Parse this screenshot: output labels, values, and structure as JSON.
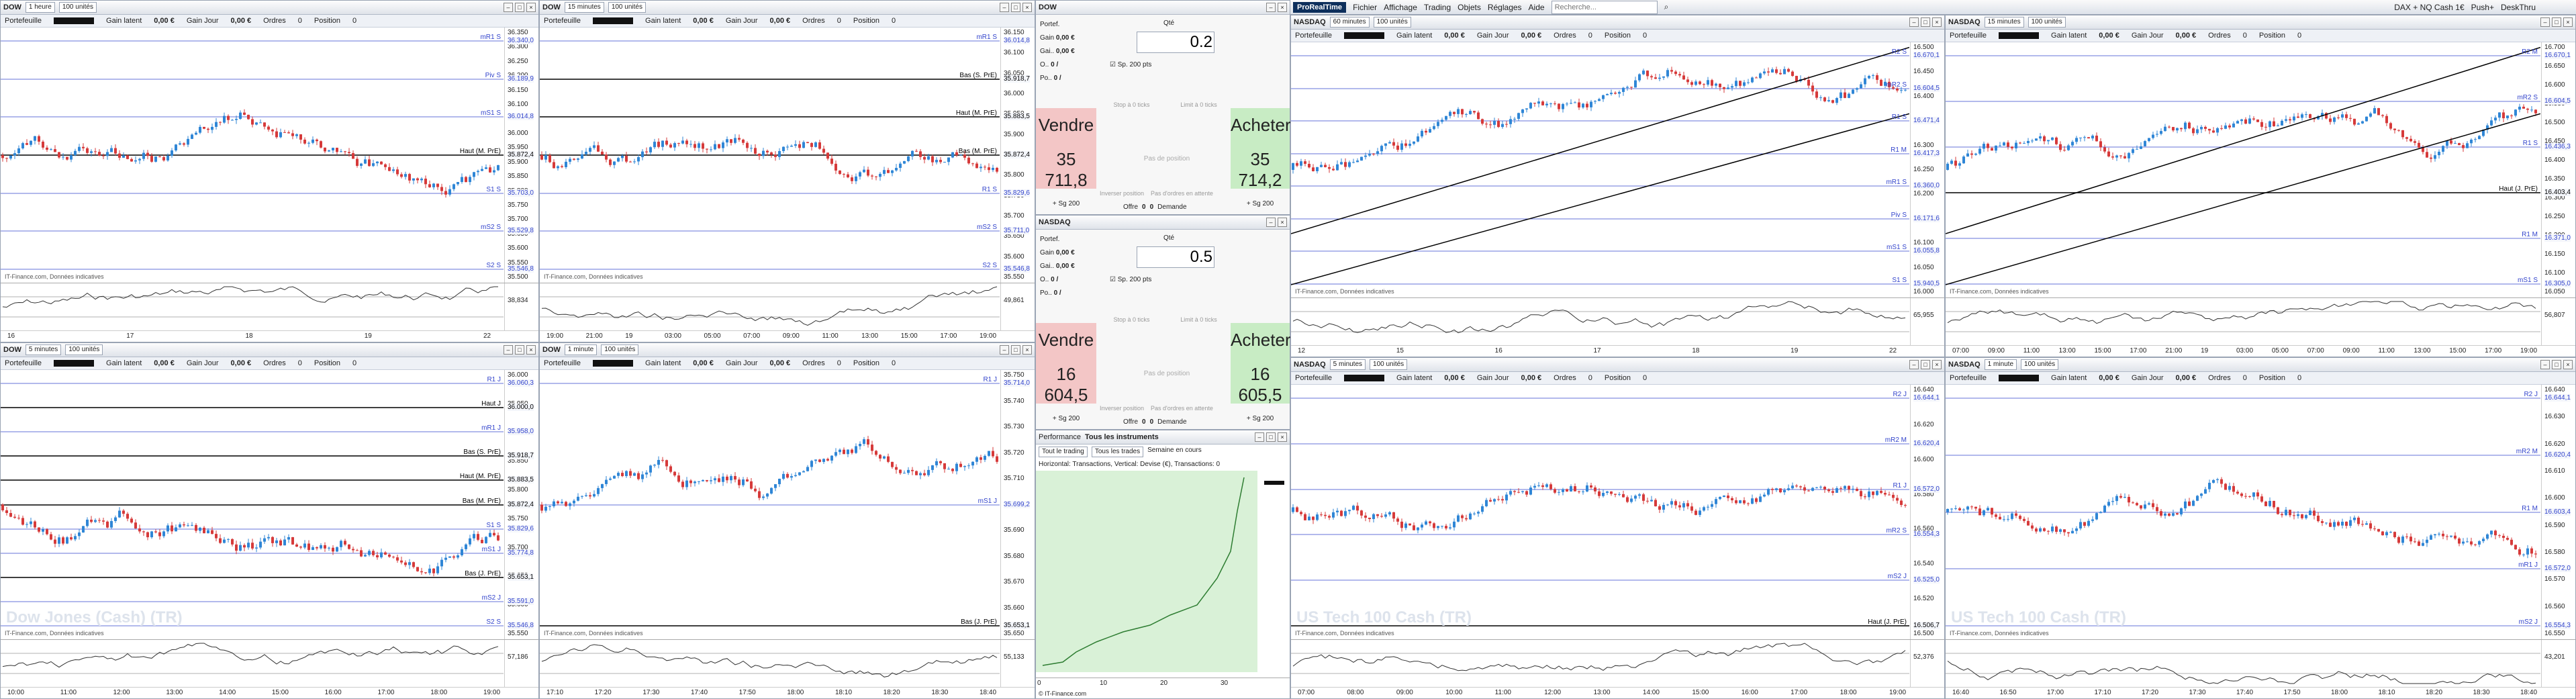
{
  "topbar": {
    "logo": "ProRealTime",
    "menus": [
      "Fichier",
      "Affichage",
      "Trading",
      "Objets",
      "Réglages",
      "Aide"
    ],
    "search_placeholder": "Recherche...",
    "right": [
      "DAX + NQ Cash 1€",
      "Push+",
      "DeskThru"
    ]
  },
  "info": {
    "portfolio": "Portefeuille",
    "latent": "Gain latent",
    "latent_val": "0,00 €",
    "day": "Gain Jour",
    "day_val": "0,00 €",
    "orders": "Ordres",
    "orders_val": "0",
    "position": "Position",
    "position_val": "0",
    "position_unit": "€"
  },
  "source": "IT-Finance.com, Données indicatives",
  "charts": [
    {
      "symbol": "DOW",
      "tf": "1 heure",
      "units": "100 unités",
      "ticks": [
        "36.350",
        "36.300",
        "36.250",
        "36.200",
        "36.150",
        "36.100",
        "36.050",
        "36.000",
        "35.950",
        "35.900",
        "35.850",
        "35.800",
        "35.750",
        "35.700",
        "35.650",
        "35.600",
        "35.550",
        "35.500"
      ],
      "xlabels": [
        "16",
        "17",
        "18",
        "19",
        "22"
      ],
      "levels": [
        "mR1 S",
        "Piv S",
        "mS1 S",
        "Haut (M. PrE)",
        "S1 S",
        "mS2 S",
        "S2 S"
      ],
      "values": [
        "36.340,0",
        "36.189,9",
        "36.014,8",
        "35.872,4",
        "35.703,0",
        "35.529,8",
        "35.546,8"
      ],
      "osc": "38,834"
    },
    {
      "symbol": "DOW",
      "tf": "15 minutes",
      "units": "100 unités",
      "ticks": [
        "36.150",
        "36.100",
        "36.050",
        "36.000",
        "35.950",
        "35.900",
        "35.850",
        "35.800",
        "35.750",
        "35.700",
        "35.650",
        "35.600",
        "35.550"
      ],
      "xlabels": [
        "19:00",
        "21:00",
        "19",
        "03:00",
        "05:00",
        "07:00",
        "09:00",
        "11:00",
        "13:00",
        "15:00",
        "17:00",
        "19:00"
      ],
      "levels": [
        "mR1 S",
        "Bas (S. PrE)",
        "Haut (M. PrE)",
        "Bas (M. PrE)",
        "R1 S",
        "mS2 S",
        "S2 S"
      ],
      "values": [
        "36.014,8",
        "35.918,7",
        "35.883,5",
        "35.872,4",
        "35.829,6",
        "35.711,0",
        "35.546,8"
      ],
      "osc": "49,861"
    },
    {
      "symbol": "DOW",
      "tf": "5 minutes",
      "units": "100 unités",
      "ticks": [
        "36.000",
        "35.950",
        "35.900",
        "35.850",
        "35.800",
        "35.750",
        "35.700",
        "35.650",
        "35.600",
        "35.550"
      ],
      "xlabels": [
        "10:00",
        "11:00",
        "12:00",
        "13:00",
        "14:00",
        "15:00",
        "16:00",
        "17:00",
        "18:00",
        "19:00"
      ],
      "levels": [
        "R1 J",
        "Haut J",
        "mR1 J",
        "Bas (S. PrE)",
        "Haut (M. PrE)",
        "Bas (M. PrE)",
        "S1 S",
        "mS1 J",
        "Bas (J. PrE)",
        "mS2 J",
        "S2 S"
      ],
      "values": [
        "36.060,3",
        "36.000,0",
        "35.958,0",
        "35.918,7",
        "35.883,5",
        "35.872,4",
        "35.829,6",
        "35.774,8",
        "35.653,1",
        "35.591,0",
        "35.546,8"
      ],
      "osc": "57,186",
      "watermark": "Dow Jones (Cash) (TR)"
    },
    {
      "symbol": "DOW",
      "tf": "1 minute",
      "units": "100 unités",
      "ticks": [
        "35.750",
        "35.740",
        "35.730",
        "35.720",
        "35.710",
        "35.700",
        "35.690",
        "35.680",
        "35.670",
        "35.660",
        "35.650"
      ],
      "xlabels": [
        "17:10",
        "17:20",
        "17:30",
        "17:40",
        "17:50",
        "18:00",
        "18:10",
        "18:20",
        "18:30",
        "18:40"
      ],
      "levels": [
        "R1 J",
        "mS1 J",
        "Bas (J. PrE)"
      ],
      "values": [
        "35.714,0",
        "35.699,2",
        "35.653,1"
      ],
      "osc": "55,133"
    },
    {
      "symbol": "NASDAQ",
      "tf": "60 minutes",
      "units": "100 unités",
      "ticks": [
        "16.500",
        "16.450",
        "16.400",
        "16.350",
        "16.300",
        "16.250",
        "16.200",
        "16.150",
        "16.100",
        "16.050",
        "16.000"
      ],
      "xlabels": [
        "12",
        "15",
        "16",
        "17",
        "18",
        "19",
        "22"
      ],
      "levels": [
        "R2 S",
        "mR2 S",
        "R1 S",
        "R1 M",
        "mR1 S",
        "Piv S",
        "mS1 S",
        "S1 S"
      ],
      "values": [
        "16.670,1",
        "16.604,5",
        "16.471,4",
        "16.417,3",
        "16.360,0",
        "16.171,6",
        "16.055,8",
        "15.940,5"
      ],
      "osc": "65,955"
    },
    {
      "symbol": "NASDAQ",
      "tf": "15 minutes",
      "units": "100 unités",
      "ticks": [
        "16.700",
        "16.650",
        "16.600",
        "16.550",
        "16.500",
        "16.450",
        "16.400",
        "16.350",
        "16.300",
        "16.250",
        "16.200",
        "16.150",
        "16.100",
        "16.050"
      ],
      "xlabels": [
        "07:00",
        "09:00",
        "11:00",
        "13:00",
        "15:00",
        "17:00",
        "21:00",
        "19",
        "03:00",
        "05:00",
        "07:00",
        "09:00",
        "11:00",
        "13:00",
        "15:00",
        "17:00",
        "19:00"
      ],
      "levels": [
        "R2 M",
        "mR2 S",
        "R1 S",
        "Haut (J. PrE)",
        "R1 M",
        "mS1 S"
      ],
      "values": [
        "16.670,1",
        "16.604,5",
        "16.436,3",
        "16.403,4",
        "16.371,0",
        "16.305,0"
      ],
      "osc": "56,807"
    },
    {
      "symbol": "NASDAQ",
      "tf": "5 minutes",
      "units": "100 unités",
      "ticks": [
        "16.640",
        "16.620",
        "16.600",
        "16.580",
        "16.560",
        "16.540",
        "16.520",
        "16.500"
      ],
      "xlabels": [
        "07:00",
        "08:00",
        "09:00",
        "10:00",
        "11:00",
        "12:00",
        "13:00",
        "14:00",
        "15:00",
        "16:00",
        "17:00",
        "18:00",
        "19:00"
      ],
      "levels": [
        "R2 J",
        "mR2 M",
        "R1 J",
        "mR2 S",
        "mS2 J",
        "Haut (J. PrE)"
      ],
      "values": [
        "16.644,1",
        "16.620,4",
        "16.572,0",
        "16.554,3",
        "16.525,0",
        "16.506,7"
      ],
      "osc": "52,376",
      "watermark": "US Tech 100 Cash (TR)"
    },
    {
      "symbol": "NASDAQ",
      "tf": "1 minute",
      "units": "100 unités",
      "ticks": [
        "16.640",
        "16.630",
        "16.620",
        "16.610",
        "16.600",
        "16.590",
        "16.580",
        "16.570",
        "16.560",
        "16.550"
      ],
      "xlabels": [
        "16:40",
        "16:50",
        "17:00",
        "17:10",
        "17:20",
        "17:30",
        "17:40",
        "17:50",
        "18:00",
        "18:10",
        "18:20",
        "18:30",
        "18:40"
      ],
      "levels": [
        "R2 J",
        "mR2 M",
        "R1 M",
        "mR1 J",
        "mS2 J"
      ],
      "values": [
        "16.644,1",
        "16.620,4",
        "16.603,4",
        "16.572,0",
        "16.554,3"
      ],
      "osc": "43,201",
      "watermark": "US Tech 100 Cash (TR)"
    }
  ],
  "tickets": [
    {
      "symbol": "DOW",
      "qty_label": "Qté",
      "qty": "0.2",
      "fields": [
        "Portef.",
        "Gain",
        "Gai..",
        "O..",
        "Po.."
      ],
      "field_vals": [
        "",
        "0,00 €",
        "0,00 €",
        "0 /",
        "0 /"
      ],
      "sl_label": "Sp.",
      "stop_pts": "200 pts",
      "sell_label": "Vendre",
      "sell_price": "35 711,8",
      "buy_label": "Acheter",
      "buy_price": "35 714,2",
      "sell_sub": "+ Sg 200",
      "buy_sub": "+ Sg 200",
      "offer": "Offre",
      "offer_val": "0",
      "demand": "Demande",
      "demand_val": "0",
      "inverse": "Inverser position",
      "no_orders": "Pas d'ordres en attente",
      "no_pos": "Pas de position",
      "stop_btn": "Stop à 0 ticks",
      "limit_btn": "Limit à 0 ticks"
    },
    {
      "symbol": "NASDAQ",
      "qty_label": "Qté",
      "qty": "0.5",
      "fields": [
        "Portef.",
        "Gain",
        "Gai..",
        "O..",
        "Po.."
      ],
      "field_vals": [
        "",
        "0,00 €",
        "0,00 €",
        "0 /",
        "0 /"
      ],
      "sl_label": "Sp.",
      "stop_pts": "200 pts",
      "sell_label": "Vendre",
      "sell_price": "16 604,5",
      "buy_label": "Acheter",
      "buy_price": "16 605,5",
      "sell_sub": "+ Sg 200",
      "buy_sub": "+ Sg 200",
      "offer": "Offre",
      "offer_val": "0",
      "demand": "Demande",
      "demand_val": "0",
      "inverse": "Inverser position",
      "no_orders": "Pas d'ordres en attente",
      "no_pos": "Pas de position",
      "stop_btn": "Stop à 0 ticks",
      "limit_btn": "Limit à 0 ticks"
    }
  ],
  "perf": {
    "tab1": "Performance",
    "tab2": "Tous les instruments",
    "f1": "Tout le trading",
    "f2": "Tous les trades",
    "f3": "Semaine en cours",
    "header": "Horizontal: Transactions, Vertical: Devise (€), Transactions: 0",
    "xticks": [
      "0",
      "10",
      "20",
      "30"
    ],
    "source": "© IT-Finance.com"
  },
  "colors": {
    "bull": "#2f86d6",
    "bear": "#d63a3a",
    "level": "#3344cc",
    "ticket_sell": "#f3c6c6",
    "ticket_buy": "#c8ecc4"
  }
}
